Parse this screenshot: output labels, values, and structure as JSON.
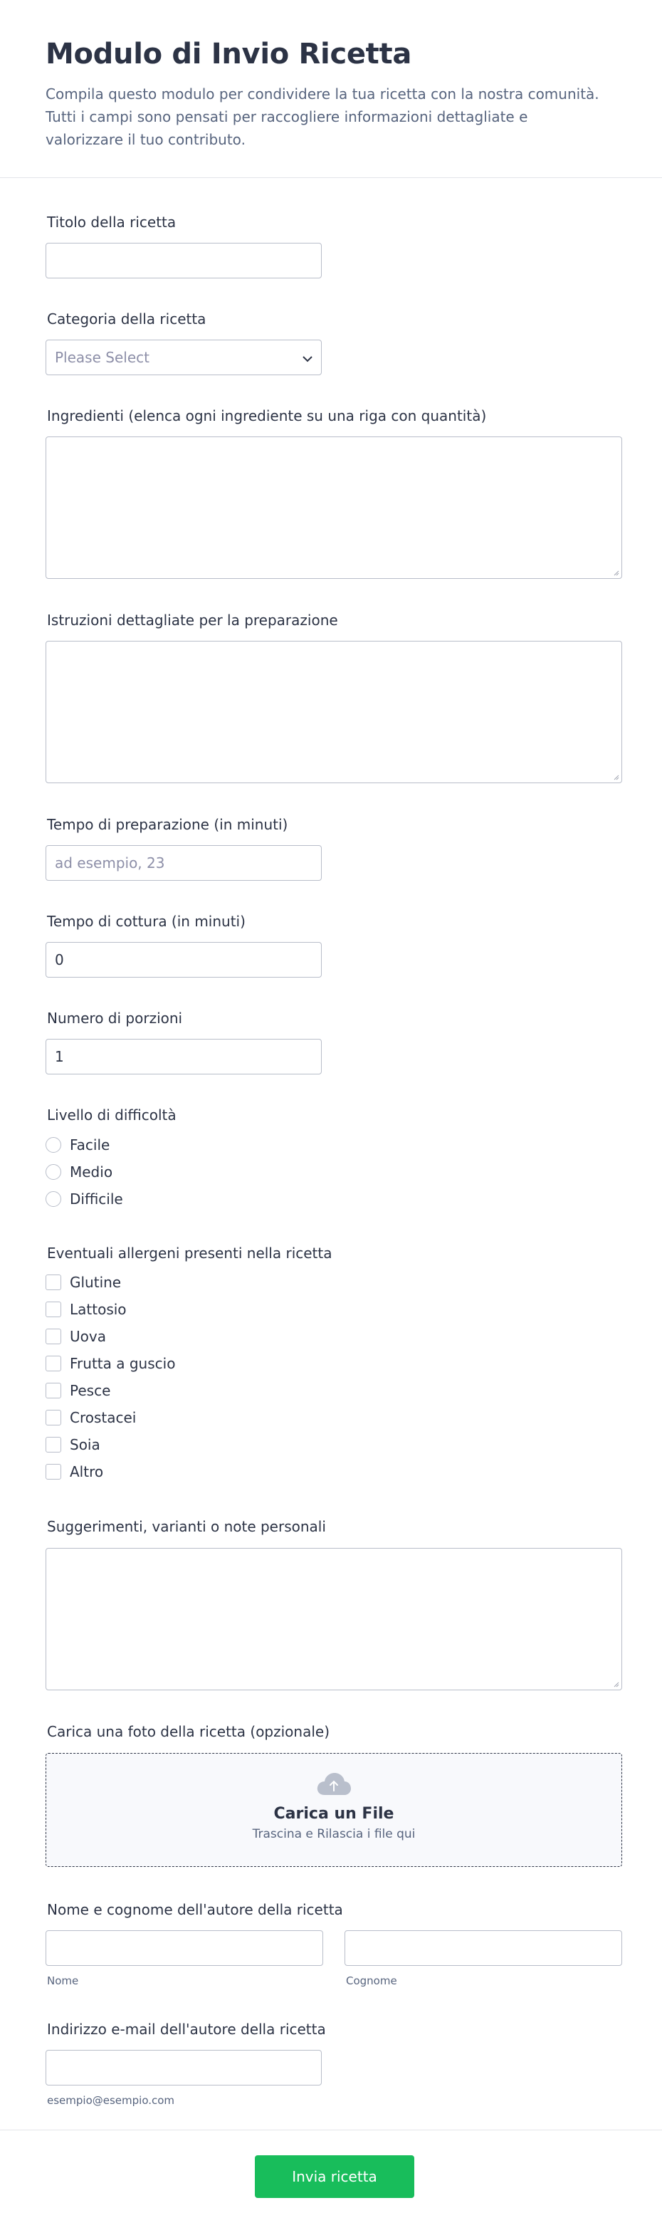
{
  "header": {
    "title": "Modulo di Invio Ricetta",
    "subtitle": "Compila questo modulo per condividere la tua ricetta con la nostra comunità. Tutti i campi sono pensati per raccogliere informazioni dettagliate e valorizzare il tuo contributo."
  },
  "fields": {
    "recipe_title": {
      "label": "Titolo della ricetta",
      "value": ""
    },
    "category": {
      "label": "Categoria della ricetta",
      "placeholder": "Please Select",
      "icon": "chevron-down-icon"
    },
    "ingredients": {
      "label": "Ingredienti (elenca ogni ingrediente su una riga con quantità)"
    },
    "instructions": {
      "label": "Istruzioni dettagliate per la preparazione"
    },
    "prep_time": {
      "label": "Tempo di preparazione (in minuti)",
      "placeholder": "ad esempio, 23"
    },
    "cook_time": {
      "label": "Tempo di cottura (in minuti)",
      "value": "0"
    },
    "servings": {
      "label": "Numero di porzioni",
      "value": "1"
    },
    "difficulty": {
      "label": "Livello di difficoltà",
      "options": [
        "Facile",
        "Medio",
        "Difficile"
      ]
    },
    "allergens": {
      "label": "Eventuali allergeni presenti nella ricetta",
      "options": [
        "Glutine",
        "Lattosio",
        "Uova",
        "Frutta a guscio",
        "Pesce",
        "Crostacei",
        "Soia",
        "Altro"
      ]
    },
    "notes": {
      "label": "Suggerimenti, varianti o note personali"
    },
    "photo": {
      "label": "Carica una foto della ricetta (opzionale)",
      "upload_title": "Carica un File",
      "upload_hint": "Trascina e Rilascia i file qui",
      "icon": "cloud-upload-icon"
    },
    "author_name": {
      "label": "Nome e cognome dell'autore della ricetta",
      "first_sublabel": "Nome",
      "last_sublabel": "Cognome"
    },
    "author_email": {
      "label": "Indirizzo e-mail dell'autore della ricetta",
      "sublabel": "esempio@esempio.com"
    }
  },
  "submit": {
    "label": "Invia ricetta"
  },
  "colors": {
    "accent": "#18bd5b",
    "text": "#2c3345",
    "border": "#b8bdc9"
  }
}
